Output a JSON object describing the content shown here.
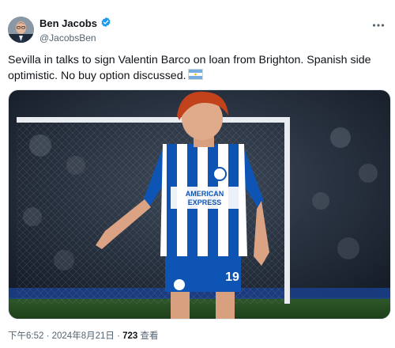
{
  "tweet": {
    "author": {
      "display_name": "Ben Jacobs",
      "handle": "@JacobsBen",
      "verified": true
    },
    "text": "Sevilla in talks to sign Valentin Barco on loan from Brighton. Spanish side optimistic. No buy option discussed.",
    "flag_emoji": "🇦🇷",
    "media": {
      "shirt_sponsor": [
        "AMERICAN",
        "EXPRESS"
      ],
      "shirt_number": "19"
    },
    "meta": {
      "time": "下午6:52",
      "sep1": " · ",
      "date": "2024年8月21日",
      "sep2": " · ",
      "views_count": "723",
      "views_label": " 查看"
    }
  },
  "colors": {
    "verified_blue": "#1d9bf0",
    "text_primary": "#0f1419",
    "text_secondary": "#536471",
    "kit_blue": "#0d54b4"
  },
  "icons": [
    "avatar",
    "verified-badge-icon",
    "more-icon",
    "argentina-flag-icon"
  ]
}
